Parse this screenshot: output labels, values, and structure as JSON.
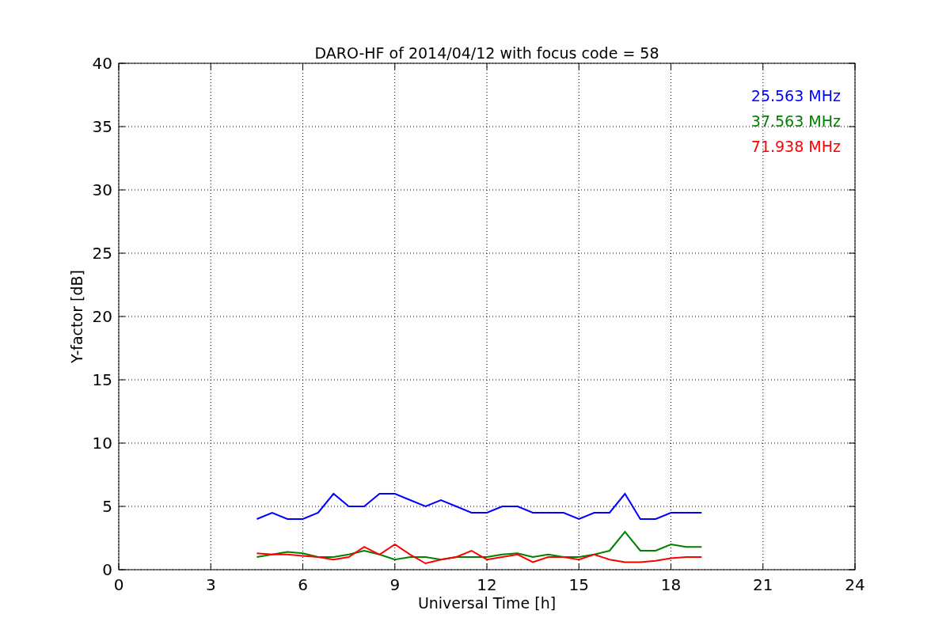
{
  "chart_data": {
    "type": "line",
    "title": "DARO-HF of 2014/04/12 with focus code = 58",
    "xlabel": "Universal Time [h]",
    "ylabel": "Y-factor [dB]",
    "x": [
      4.5,
      5,
      5.5,
      6,
      6.5,
      7,
      7.5,
      8,
      8.5,
      9,
      9.5,
      10,
      10.5,
      11,
      11.5,
      12,
      12.5,
      13,
      13.5,
      14,
      14.5,
      15,
      15.5,
      16,
      16.5,
      17,
      17.5,
      18,
      18.5,
      19
    ],
    "series": [
      {
        "name": "25.563 MHz",
        "color": "#0000ff",
        "values": [
          4,
          4.5,
          4,
          4,
          4.5,
          6,
          5,
          5,
          6,
          6,
          5.5,
          5,
          5.5,
          5,
          4.5,
          4.5,
          5,
          5,
          4.5,
          4.5,
          4.5,
          4,
          4.5,
          4.5,
          6,
          4,
          4,
          4.5,
          4.5,
          4.5
        ]
      },
      {
        "name": "37.563 MHz",
        "color": "#008000",
        "values": [
          1,
          1.2,
          1.4,
          1.3,
          1,
          1,
          1.2,
          1.5,
          1.2,
          0.8,
          1,
          1,
          0.8,
          1,
          1,
          1,
          1.2,
          1.3,
          1,
          1.2,
          1,
          1,
          1.2,
          1.5,
          3,
          1.5,
          1.5,
          2,
          1.8,
          1.8
        ]
      },
      {
        "name": "71.938 MHz",
        "color": "#ff0000",
        "values": [
          1.3,
          1.2,
          1.2,
          1.1,
          1,
          0.8,
          1,
          1.8,
          1.2,
          2,
          1.2,
          0.5,
          0.8,
          1,
          1.5,
          0.8,
          1,
          1.2,
          0.6,
          1,
          1,
          0.8,
          1.2,
          0.8,
          0.6,
          0.6,
          0.7,
          0.9,
          1,
          1
        ]
      }
    ],
    "grid": true,
    "xlim": [
      0,
      24
    ],
    "ylim": [
      0,
      40
    ],
    "xticks": [
      0,
      3,
      6,
      9,
      12,
      15,
      18,
      21,
      24
    ],
    "yticks": [
      0,
      5,
      10,
      15,
      20,
      25,
      30,
      35,
      40
    ]
  }
}
